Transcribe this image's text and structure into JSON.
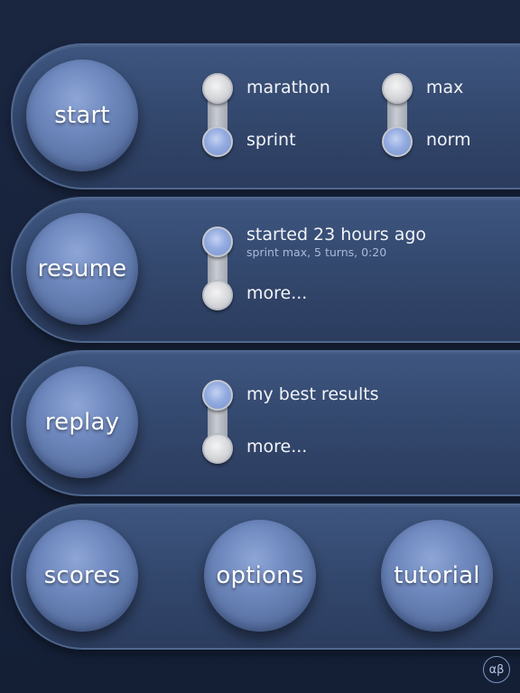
{
  "start_panel": {
    "button_label": "start",
    "left_toggle": {
      "top_label": "marathon",
      "bottom_label": "sprint",
      "selected": "sprint"
    },
    "right_toggle": {
      "top_label": "max",
      "bottom_label": "norm",
      "selected": "norm"
    }
  },
  "resume_panel": {
    "button_label": "resume",
    "top_label": "started 23 hours ago",
    "top_sublabel": "sprint max, 5 turns, 0:20",
    "bottom_label": "more...",
    "selected": "top"
  },
  "replay_panel": {
    "button_label": "replay",
    "top_label": "my best results",
    "bottom_label": "more...",
    "selected": "top"
  },
  "bottom_panel": {
    "scores_label": "scores",
    "options_label": "options",
    "tutorial_label": "tutorial"
  },
  "corner_button": {
    "label": "αβ"
  },
  "colors": {
    "background": "#17233b",
    "panel": "#3a5179",
    "ball": "#6f89bf",
    "knob_selected": "#93abe0",
    "knob_unselected": "#d9dadd"
  }
}
